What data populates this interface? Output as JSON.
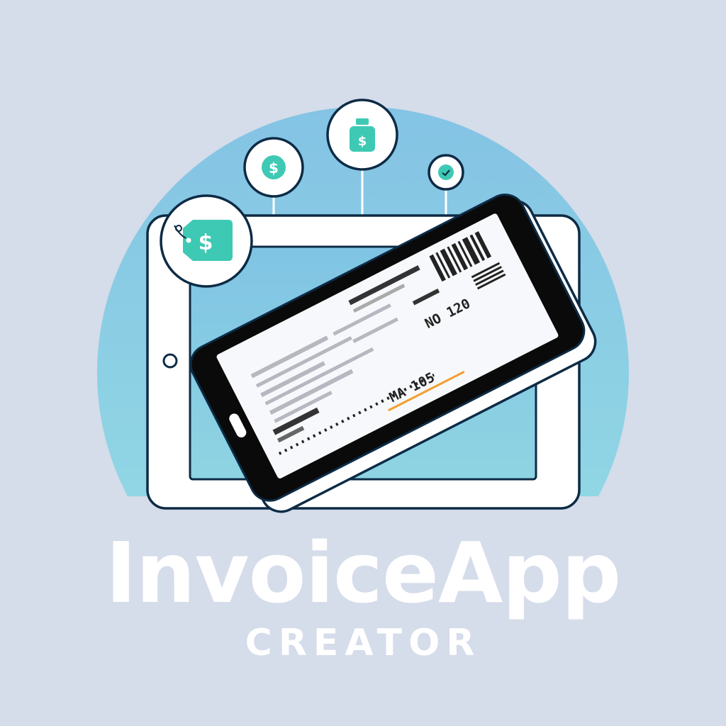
{
  "logo": {
    "wordmark": "InvoiceApp",
    "tagline": "CREATOR",
    "receipt_text_1": "NO 120",
    "receipt_text_2": "MA 105",
    "currency_symbol": "$"
  },
  "icons": [
    "price-tag-icon",
    "coin-dollar-icon",
    "money-jar-icon",
    "check-icon",
    "smartphone-icon",
    "tablet-icon",
    "receipt-icon"
  ],
  "colors": {
    "background": "#d5dcea",
    "circle": "#87c8e4",
    "accent_teal": "#3ec9b4",
    "outline": "#0d2b45",
    "white": "#ffffff",
    "receipt_orange": "#f0a030"
  }
}
